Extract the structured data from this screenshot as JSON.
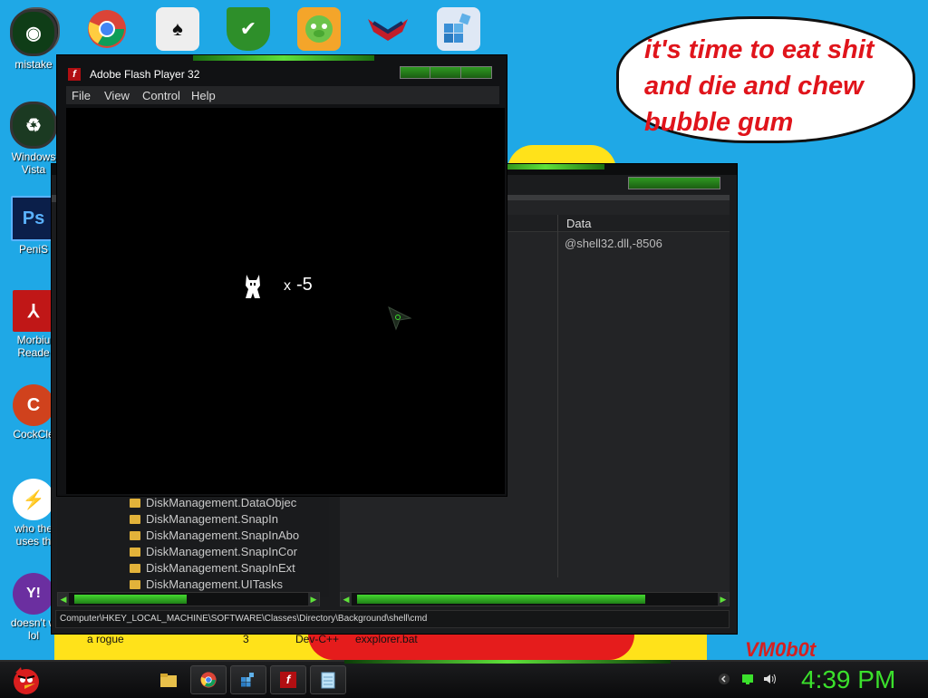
{
  "wallpaper": {
    "bubble_lines": [
      "it's time to eat shit",
      "and die and chew",
      "bubble gum"
    ],
    "bottom_texts": [
      "a rogue",
      "3",
      "Dev-C++",
      "exxplorer.bat"
    ],
    "watermark": "VM0b0t"
  },
  "desktop_icons": [
    {
      "label": "mistake",
      "icon": "green-orb-icon",
      "color": "#1a6e2a"
    },
    {
      "label": "Windows\nVista",
      "icon": "recycle-bin-icon",
      "color": "#1b7a3a"
    },
    {
      "label": "PeniS",
      "icon": "photoshop-icon",
      "color": "#1c3a7a"
    },
    {
      "label": "Morbiu\nReade",
      "icon": "pdf-reader-icon",
      "color": "#c01717"
    },
    {
      "label": "CockCle",
      "icon": "ccleaner-icon",
      "color": "#d0421d"
    },
    {
      "label": "who the\nuses th",
      "icon": "lightning-icon",
      "color": "#ffffff"
    },
    {
      "label": "doesn't w\nlol",
      "icon": "yahoo-messenger-icon",
      "color": "#6b2fa0"
    }
  ],
  "top_icons": [
    {
      "name": "cmd-icon",
      "color": "#1e1e1e"
    },
    {
      "name": "chrome-icon",
      "color": "#ffffff"
    },
    {
      "name": "solitaire-icon",
      "color": "#eaeaea"
    },
    {
      "name": "shield-check-icon",
      "color": "#3a9a2a"
    },
    {
      "name": "angry-birds-pig-icon",
      "color": "#f4a52a"
    },
    {
      "name": "bat-logo-icon",
      "color": "#2a2a7a"
    },
    {
      "name": "registry-icon",
      "color": "#dfe8f5"
    }
  ],
  "regedit": {
    "column_data": "Data",
    "value_data": "@shell32.dll,-8506",
    "tree_items": [
      "DiskManagement.DataObjec",
      "DiskManagement.SnapIn",
      "DiskManagement.SnapInAbo",
      "DiskManagement.SnapInCor",
      "DiskManagement.SnapInExt",
      "DiskManagement.UITasks"
    ],
    "status_path": "Computer\\HKEY_LOCAL_MACHINE\\SOFTWARE\\Classes\\Directory\\Background\\shell\\cmd"
  },
  "flash": {
    "title": "Adobe Flash Player 32",
    "menu": [
      "File",
      "View",
      "Control",
      "Help"
    ],
    "lives_sign": "x",
    "lives_value": "-5"
  },
  "taskbar": {
    "time": "4:39 PM",
    "buttons": [
      "explorer-icon",
      "chrome-icon",
      "regedit-icon",
      "flash-player-icon",
      "notepad-icon"
    ]
  }
}
